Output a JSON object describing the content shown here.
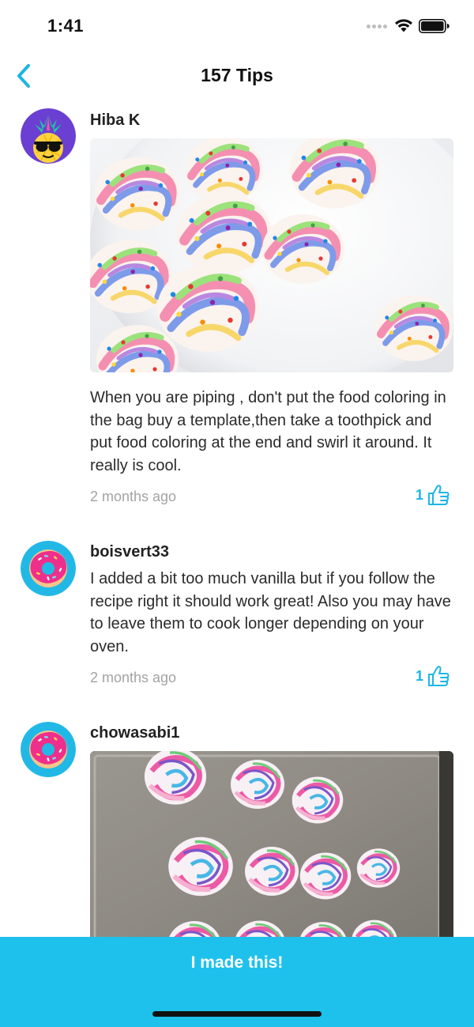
{
  "status_bar": {
    "time": "1:41"
  },
  "nav": {
    "title": "157 Tips"
  },
  "tips": [
    {
      "username": "Hiba K",
      "text": "When you are piping , don't put the food coloring in the bag buy a template,then take a toothpick and put food coloring at the end and swirl it around. It really is cool.",
      "time": "2 months ago",
      "likes": "1",
      "avatar_icon": "pineapple-sunglasses-avatar",
      "photo": "rainbow-meringues-on-plate"
    },
    {
      "username": "boisvert33",
      "text": "I added a bit too much vanilla but if you follow the recipe right it should work great! Also you may have to leave them to cook longer depending on your oven.",
      "time": "2 months ago",
      "likes": "1",
      "avatar_icon": "donut-avatar"
    },
    {
      "username": "chowasabi1",
      "avatar_icon": "donut-avatar",
      "photo": "rainbow-meringues-on-baking-tray"
    }
  ],
  "cta": {
    "label": "I made this!"
  },
  "colors": {
    "accent": "#1ec1ec",
    "like": "#1cb6e4",
    "muted": "#a3a3a3"
  }
}
